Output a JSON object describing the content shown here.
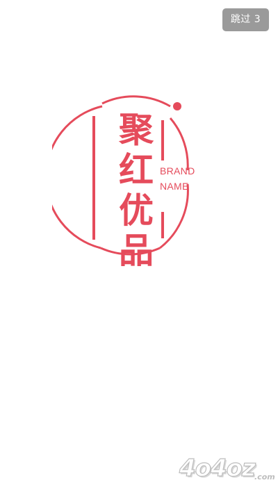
{
  "skip_button": {
    "label": "跳过 3"
  },
  "logo": {
    "chars": [
      "聚",
      "红",
      "优",
      "品"
    ],
    "brand_line1": "BRAND",
    "brand_line2": "NAME",
    "accent_color": "#e54b5b"
  },
  "watermark": {
    "main": "4o4oz",
    "suffix": ".com"
  }
}
